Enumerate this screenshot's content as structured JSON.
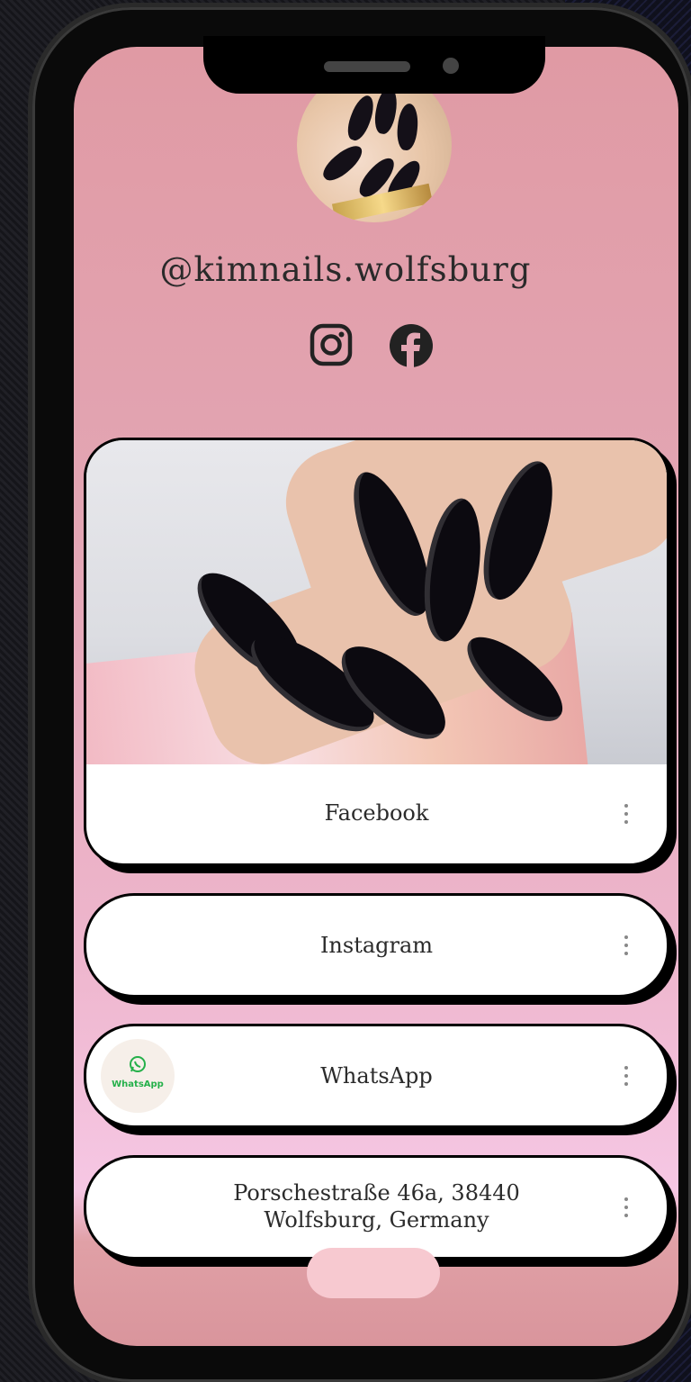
{
  "profile": {
    "username": "@kimnails.wolfsburg",
    "avatar_alt": "avatar"
  },
  "socials": [
    {
      "name": "instagram-icon"
    },
    {
      "name": "facebook-icon"
    }
  ],
  "links": {
    "facebook": {
      "label": "Facebook"
    },
    "instagram": {
      "label": "Instagram"
    },
    "whatsapp": {
      "label": "WhatsApp",
      "thumb_text": "WhatsApp"
    },
    "address": {
      "line1": "Porschestraße 46a, 38440",
      "line2": "Wolfsburg, Germany"
    }
  },
  "colors": {
    "background_top": "#e09aa4",
    "background_bottom": "#f6c7e4",
    "card": "#ffffff",
    "card_shadow": "#000000",
    "whatsapp_green": "#25b04a"
  }
}
